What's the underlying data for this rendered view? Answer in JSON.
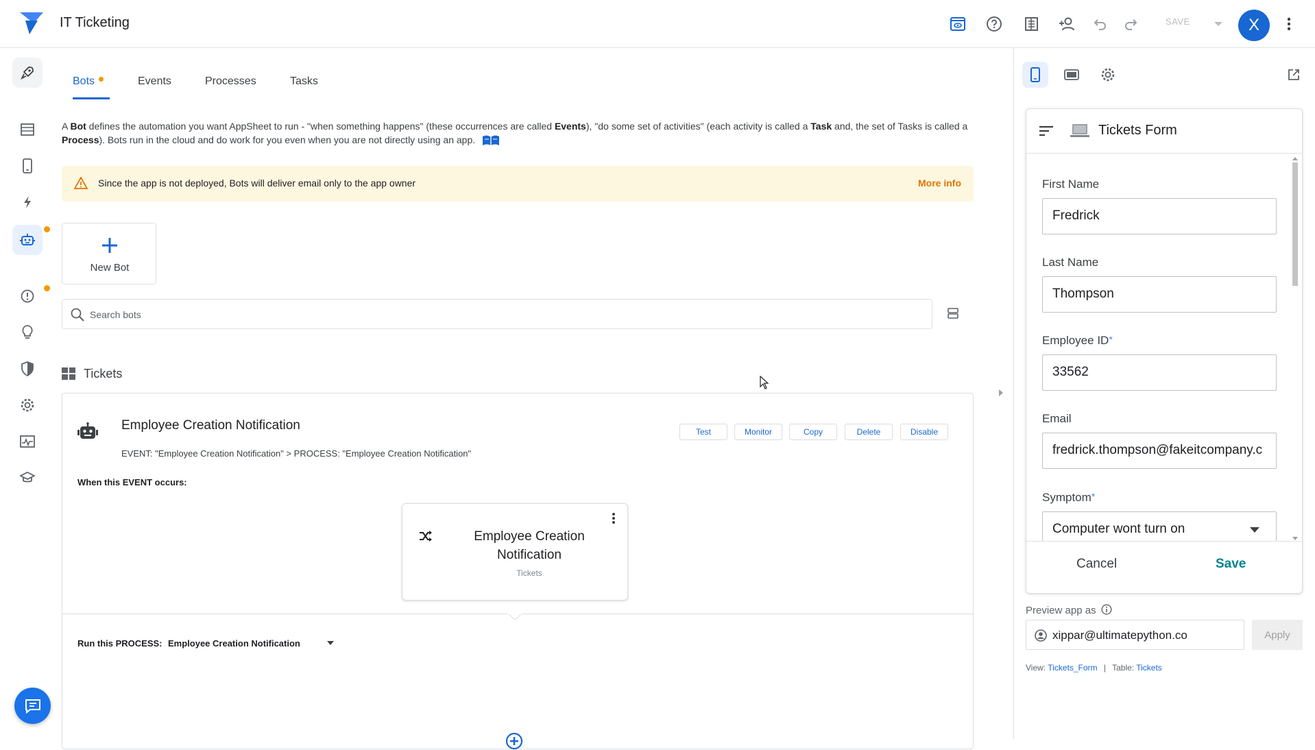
{
  "app": {
    "title": "IT Ticketing",
    "save_label": "SAVE",
    "avatar_letter": "X"
  },
  "tabs": [
    {
      "label": "Bots"
    },
    {
      "label": "Events"
    },
    {
      "label": "Processes"
    },
    {
      "label": "Tasks"
    }
  ],
  "description": {
    "p1": "A ",
    "b1": "Bot",
    "p2": " defines the automation you want AppSheet to run - \"when something happens\" (these occurrences are called ",
    "b2": "Events",
    "p3": "), \"do some set of activities\" (each activity is called a ",
    "b3": "Task",
    "p4": " and, the set of Tasks is called a ",
    "b4": "Process",
    "p5": "). Bots run in the cloud and do work for you even when you are not directly using an app."
  },
  "warning": {
    "text": "Since the app is not deployed, Bots will deliver email only to the app owner",
    "link": "More info"
  },
  "new_bot_label": "New Bot",
  "search": {
    "placeholder": "Search bots"
  },
  "section_title": "Tickets",
  "bot": {
    "name": "Employee Creation Notification",
    "subtitle": "EVENT: \"Employee Creation Notification\" > PROCESS: \"Employee Creation Notification\"",
    "actions": [
      "Test",
      "Monitor",
      "Copy",
      "Delete",
      "Disable"
    ],
    "when_label": "When this EVENT occurs:",
    "event": {
      "name": "Employee Creation Notification",
      "table": "Tickets"
    },
    "run_label": "Run this PROCESS:",
    "run_value": "Employee Creation Notification"
  },
  "preview": {
    "form_title": "Tickets Form",
    "fields": [
      {
        "label": "First Name",
        "value": "Fredrick",
        "required": false
      },
      {
        "label": "Last Name",
        "value": "Thompson",
        "required": false
      },
      {
        "label": "Employee ID",
        "value": "33562",
        "required": true
      },
      {
        "label": "Email",
        "value": "fredrick.thompson@fakeitcompany.c",
        "required": false
      },
      {
        "label": "Symptom",
        "value": "Computer wont turn on",
        "required": true
      }
    ],
    "required_mark": "*",
    "cancel_label": "Cancel",
    "save_label": "Save",
    "preview_as_label": "Preview app as",
    "preview_as_value": "xippar@ultimatepython.co",
    "apply_label": "Apply",
    "view_label": "View:",
    "view_value": "Tickets_Form",
    "separator": "|",
    "table_label": "Table:",
    "table_value": "Tickets"
  },
  "colors": {
    "accent": "#1967d2",
    "warning_bg": "#fef7e0",
    "warning_text": "#e37400",
    "badge": "#f29900"
  }
}
